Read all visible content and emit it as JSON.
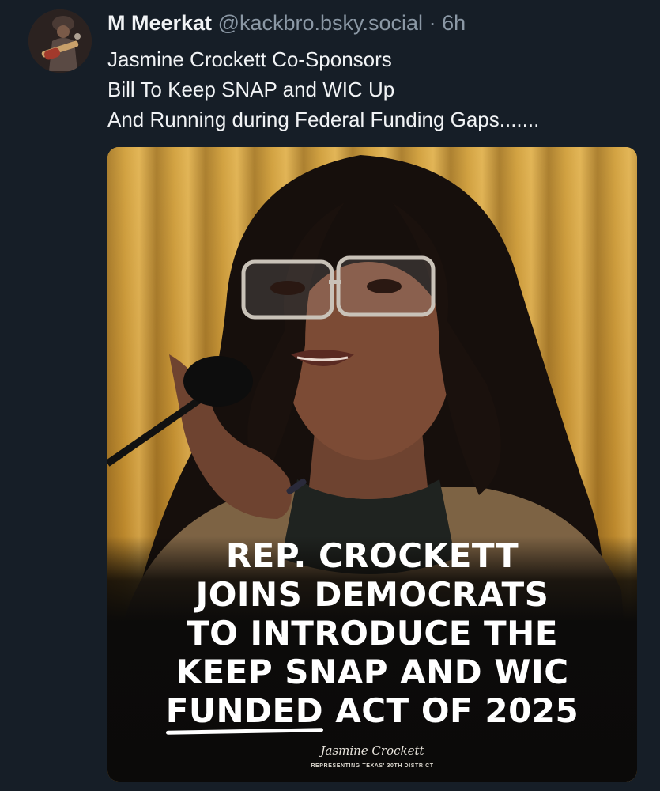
{
  "post": {
    "author_name": "M Meerkat",
    "author_handle": "@kackbro.bsky.social",
    "separator": "·",
    "time": "6h",
    "text_lines": [
      "Jasmine Crockett Co-Sponsors",
      "Bill To Keep SNAP and WIC Up",
      "And Running during Federal Funding Gaps......."
    ]
  },
  "media": {
    "headline_lines": [
      "REP. CROCKETT",
      "JOINS DEMOCRATS",
      "TO INTRODUCE THE",
      "KEEP SNAP AND WIC"
    ],
    "headline_last_underlined": "FUNDED",
    "headline_last_rest": " ACT OF 2025",
    "signature": "Jasmine Crockett",
    "subtitle": "REPRESENTING TEXAS' 30TH DISTRICT"
  },
  "colors": {
    "background": "#161e27",
    "text_primary": "#f1f3f5",
    "text_secondary": "#8b98a5"
  },
  "icons": {
    "avatar": "profile-photo"
  }
}
